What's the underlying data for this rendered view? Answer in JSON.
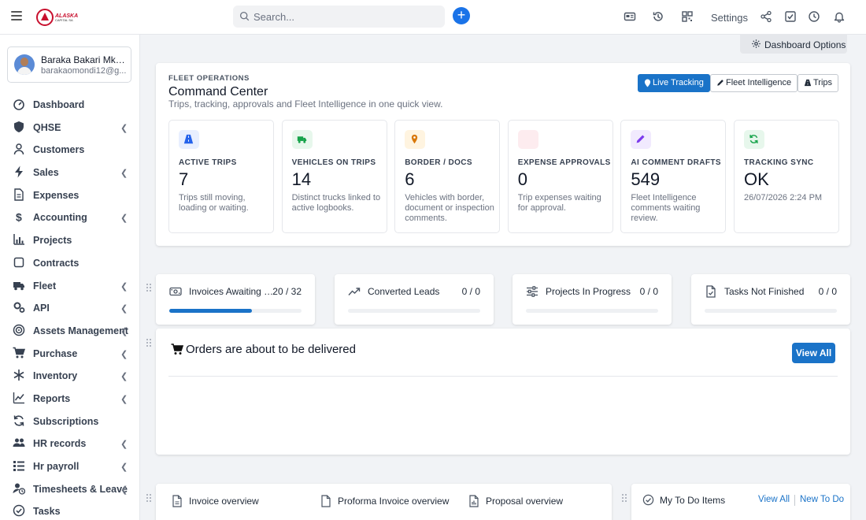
{
  "header": {
    "logo": {
      "brand": "ALASKA",
      "tagline": "CAPITAL SA"
    },
    "search": {
      "placeholder": "Search...",
      "value": ""
    },
    "settings_label": "Settings"
  },
  "user": {
    "name": "Baraka Bakari Mkan...",
    "email": "barakaomondi12@g..."
  },
  "sidebar": {
    "items": [
      {
        "label": "Dashboard",
        "icon": "gauge-icon",
        "has_children": false
      },
      {
        "label": "QHSE",
        "icon": "shield-icon",
        "has_children": true
      },
      {
        "label": "Customers",
        "icon": "user-icon",
        "has_children": false
      },
      {
        "label": "Sales",
        "icon": "bolt-icon",
        "has_children": true
      },
      {
        "label": "Expenses",
        "icon": "file-icon",
        "has_children": false
      },
      {
        "label": "Accounting",
        "icon": "dollar-icon",
        "has_children": true
      },
      {
        "label": "Projects",
        "icon": "chart-bars-icon",
        "has_children": false
      },
      {
        "label": "Contracts",
        "icon": "square-icon",
        "has_children": false
      },
      {
        "label": "Fleet",
        "icon": "truck-icon",
        "has_children": true
      },
      {
        "label": "API",
        "icon": "cogs-icon",
        "has_children": true
      },
      {
        "label": "Assets Management",
        "icon": "target-icon",
        "has_children": true
      },
      {
        "label": "Purchase",
        "icon": "cart-icon",
        "has_children": true
      },
      {
        "label": "Inventory",
        "icon": "snowflake-icon",
        "has_children": true
      },
      {
        "label": "Reports",
        "icon": "line-chart-icon",
        "has_children": true
      },
      {
        "label": "Subscriptions",
        "icon": "refresh-icon",
        "has_children": false
      },
      {
        "label": "HR records",
        "icon": "users-icon",
        "has_children": true
      },
      {
        "label": "Hr payroll",
        "icon": "list-icon",
        "has_children": true
      },
      {
        "label": "Timesheets & Leave",
        "icon": "user-clock-icon",
        "has_children": true
      },
      {
        "label": "Tasks",
        "icon": "check-circle-icon",
        "has_children": false
      }
    ]
  },
  "dashboard_options_label": "Dashboard Options",
  "command_center": {
    "eyebrow": "FLEET OPERATIONS",
    "title": "Command Center",
    "subtitle": "Trips, tracking, approvals and Fleet Intelligence in one quick view.",
    "buttons": {
      "live_tracking": "Live Tracking",
      "fleet_intelligence": "Fleet Intelligence",
      "trips": "Trips"
    },
    "stats": [
      {
        "label": "ACTIVE TRIPS",
        "value": "7",
        "desc": "Trips still moving, loading or waiting.",
        "icon": "road-icon",
        "color": "#2563eb",
        "bg": "#e8efff"
      },
      {
        "label": "VEHICLES ON TRIPS",
        "value": "14",
        "desc": "Distinct trucks linked to active logbooks.",
        "icon": "truck-icon",
        "color": "#16a34a",
        "bg": "#e7f7ec"
      },
      {
        "label": "BORDER / DOCS",
        "value": "6",
        "desc": "Vehicles with border, document or inspection comments.",
        "icon": "pin-icon",
        "color": "#d97706",
        "bg": "#fff4e0"
      },
      {
        "label": "EXPENSE APPROVALS",
        "value": "0",
        "desc": "Trip expenses waiting for approval.",
        "icon": "receipt-icon",
        "color": "#e11d48",
        "bg": "#fdecef"
      },
      {
        "label": "AI COMMENT DRAFTS",
        "value": "549",
        "desc": "Fleet Intelligence comments waiting review.",
        "icon": "pencil-icon",
        "color": "#7c3aed",
        "bg": "#f1eafe"
      },
      {
        "label": "TRACKING SYNC",
        "value": "OK",
        "desc": "26/07/2026 2:24 PM",
        "icon": "sync-icon",
        "color": "#16a34a",
        "bg": "#e7f7ec"
      }
    ]
  },
  "widgets": [
    {
      "label": "Invoices Awaiting Payment",
      "count": "20 / 32",
      "progress": 0.625,
      "icon": "money-icon"
    },
    {
      "label": "Converted Leads",
      "count": "0 / 0",
      "progress": 0,
      "icon": "trend-icon"
    },
    {
      "label": "Projects In Progress",
      "count": "0 / 0",
      "progress": 0,
      "icon": "sliders-icon"
    },
    {
      "label": "Tasks Not Finished",
      "count": "0 / 0",
      "progress": 0,
      "icon": "file-check-icon"
    }
  ],
  "orders": {
    "title": "Orders are about to be delivered",
    "view_all": "View All"
  },
  "overview_tabs": [
    "Invoice overview",
    "Proforma Invoice overview",
    "Proposal overview"
  ],
  "todo": {
    "title": "My To Do Items",
    "view_all": "View All",
    "new": "New To Do"
  },
  "colors": {
    "primary": "#1a73c8",
    "plus": "#1a73e8",
    "brand": "#c8102e"
  }
}
